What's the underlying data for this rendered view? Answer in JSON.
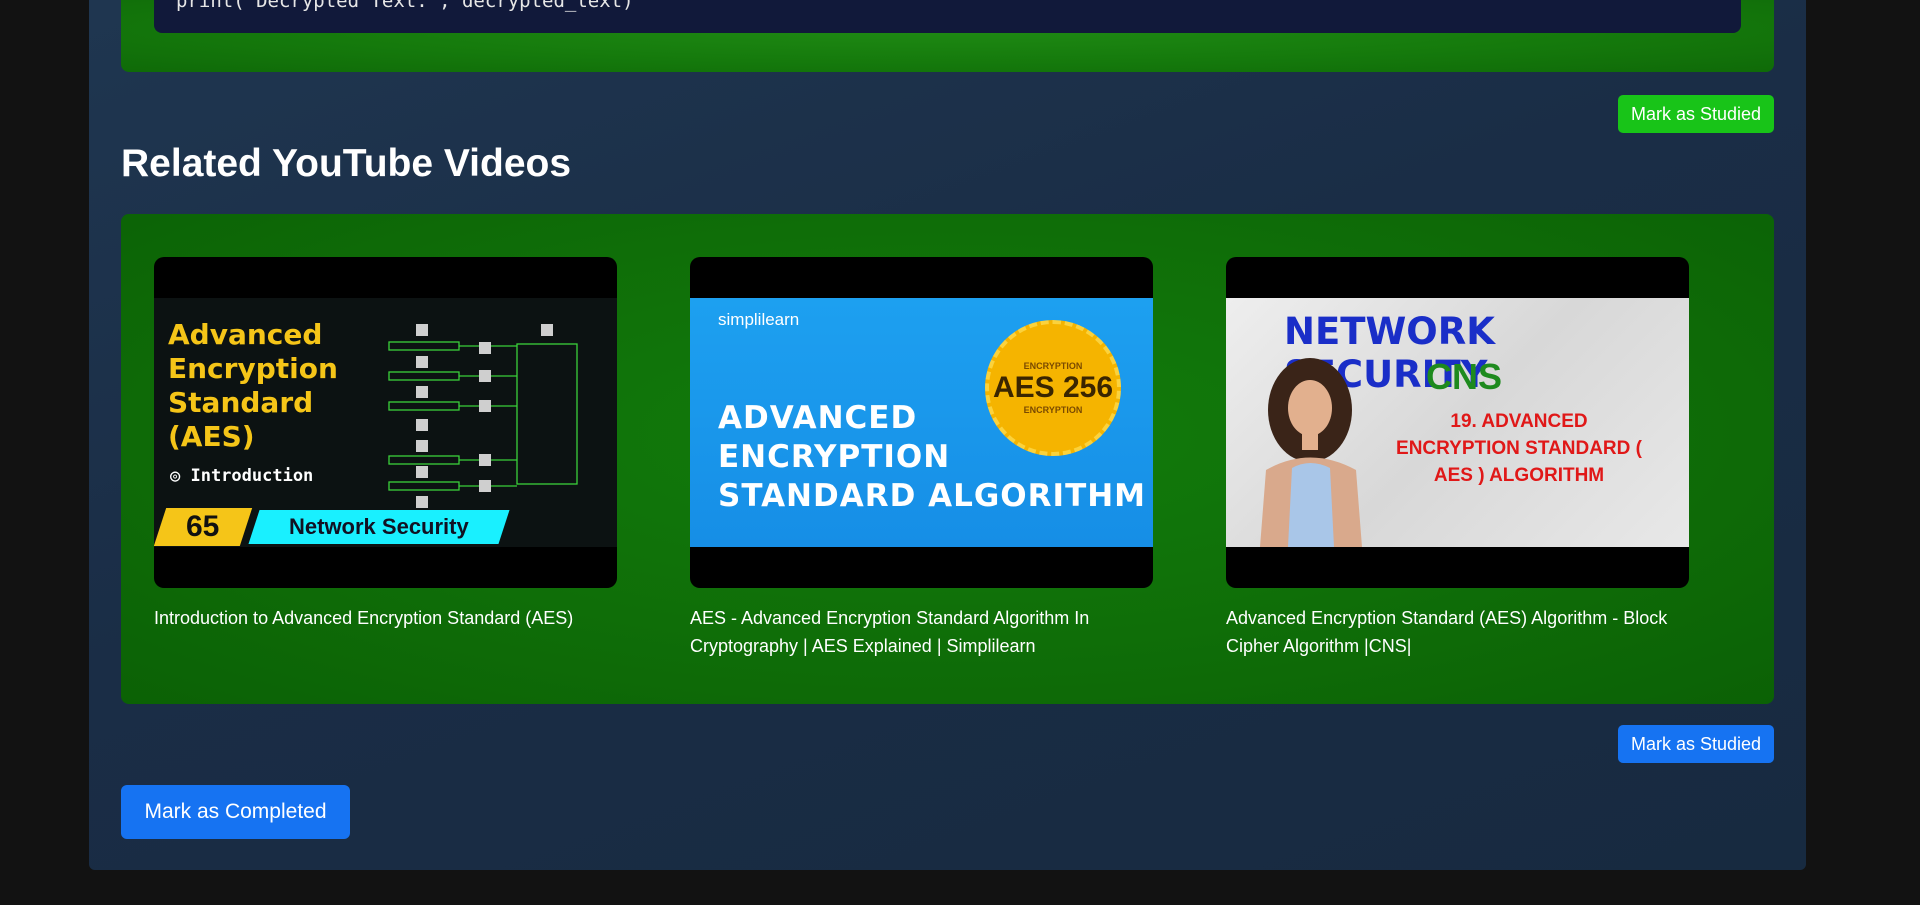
{
  "code": {
    "line": "print(\"Decrypted Text:\", decrypted_text)"
  },
  "buttons": {
    "mark_studied_1": "Mark as Studied",
    "mark_studied_2": "Mark as Studied",
    "mark_completed": "Mark as Completed"
  },
  "section": {
    "title": "Related YouTube Videos"
  },
  "videos": [
    {
      "title": "Introduction to Advanced Encryption Standard (AES)",
      "thumbnail": {
        "heading": "Advanced Encryption Standard (AES)",
        "subtitle": "◎ Introduction",
        "number": "65",
        "banner": "Network Security"
      }
    },
    {
      "title": "AES - Advanced Encryption Standard Algorithm In Cryptography | AES Explained | Simplilearn",
      "thumbnail": {
        "brand": "simplilearn",
        "seal_ring": "ENCRYPTION",
        "seal_text": "AES 256",
        "headline": "ADVANCED ENCRYPTION STANDARD ALGORITHM"
      }
    },
    {
      "title": "Advanced Encryption Standard (AES) Algorithm - Block Cipher Algorithm |CNS|",
      "thumbnail": {
        "heading": "NETWORK SECURITY",
        "sub": "CNS",
        "topic": "19. ADVANCED ENCRYPTION STANDARD ( AES ) ALGORITHM"
      }
    }
  ],
  "colors": {
    "green_button": "#18c418",
    "blue_button": "#1673f2",
    "panel_green": "#127c0c"
  }
}
